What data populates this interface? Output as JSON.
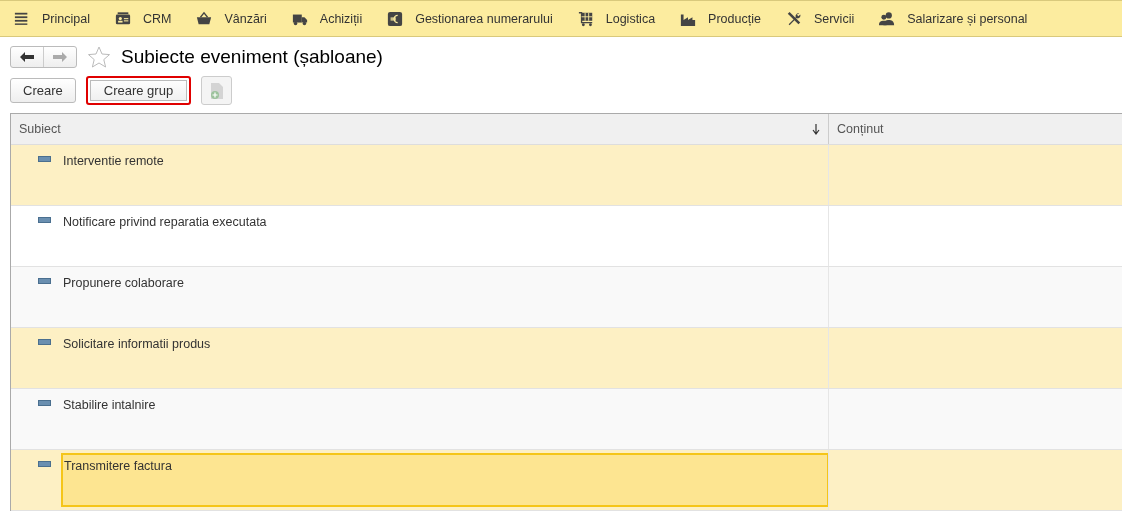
{
  "menu": [
    {
      "label": "Principal"
    },
    {
      "label": "CRM"
    },
    {
      "label": "Vânzări"
    },
    {
      "label": "Achiziții"
    },
    {
      "label": "Gestionarea numerarului"
    },
    {
      "label": "Logistica"
    },
    {
      "label": "Producție"
    },
    {
      "label": "Servicii"
    },
    {
      "label": "Salarizare și personal"
    }
  ],
  "title": "Subiecte eveniment (șabloane)",
  "favorite": false,
  "buttons": [
    {
      "label": "Creare",
      "highlighted": false
    },
    {
      "label": "Creare grup",
      "highlighted": true
    }
  ],
  "table": {
    "columns": [
      {
        "label": "Subiect",
        "sorted": true
      },
      {
        "label": "Conținut",
        "sorted": false
      }
    ],
    "rows": [
      {
        "subject": "Interventie remote",
        "selected": true,
        "current": false
      },
      {
        "subject": "Notificare privind reparatia executata",
        "selected": false,
        "current": false
      },
      {
        "subject": "Propunere colaborare",
        "selected": false,
        "current": false
      },
      {
        "subject": "Solicitare informatii produs",
        "selected": true,
        "current": false
      },
      {
        "subject": "Stabilire intalnire",
        "selected": false,
        "current": false
      },
      {
        "subject": "Transmitere factura",
        "selected": true,
        "current": true
      }
    ]
  }
}
